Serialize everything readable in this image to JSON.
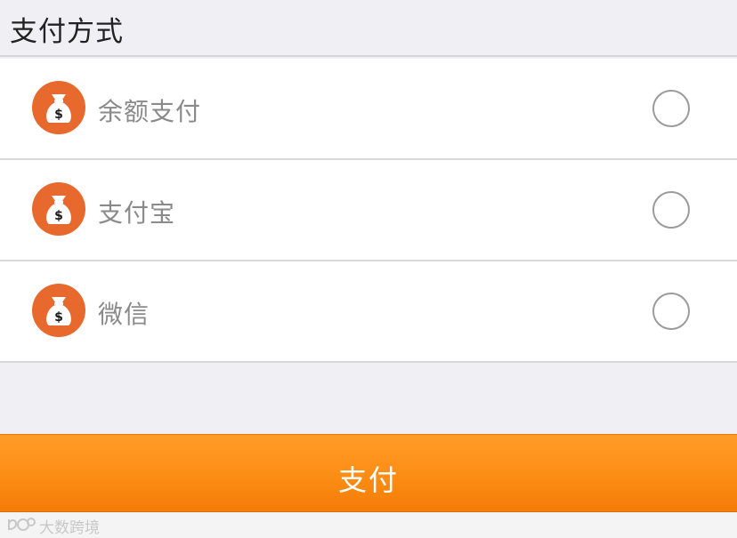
{
  "header": {
    "title": "支付方式"
  },
  "payment_options": [
    {
      "label": "余额支付",
      "icon": "money-bag-icon",
      "selected": false
    },
    {
      "label": "支付宝",
      "icon": "money-bag-icon",
      "selected": false
    },
    {
      "label": "微信",
      "icon": "money-bag-icon",
      "selected": false
    }
  ],
  "pay_button": {
    "label": "支付"
  },
  "watermark": {
    "text": "大数跨境"
  },
  "colors": {
    "icon_circle": "#e8692e",
    "pay_button": "#fb8d14",
    "background": "#efeff4"
  }
}
